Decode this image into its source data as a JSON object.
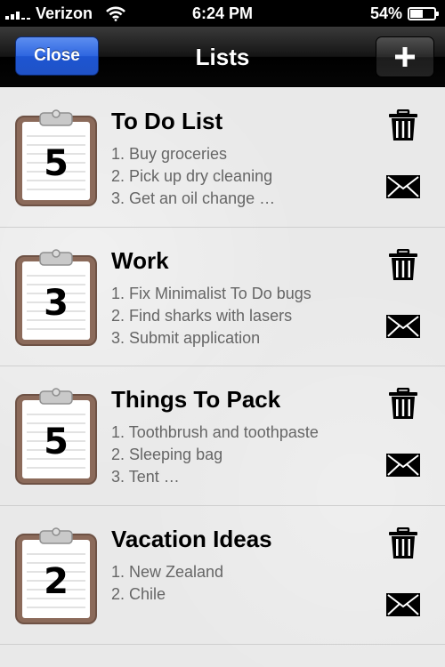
{
  "status_bar": {
    "carrier": "Verizon",
    "time": "6:24 PM",
    "battery_percent": "54%",
    "battery_level": 0.54
  },
  "nav": {
    "close_label": "Close",
    "title": "Lists",
    "add_label": "+"
  },
  "lists": [
    {
      "title": "To Do List",
      "count": "5",
      "items": [
        "1. Buy groceries",
        "2. Pick up dry cleaning",
        "3. Get an oil change …"
      ]
    },
    {
      "title": "Work",
      "count": "3",
      "items": [
        "1. Fix Minimalist To Do bugs",
        "2. Find sharks with lasers",
        "3. Submit application"
      ]
    },
    {
      "title": "Things To Pack",
      "count": "5",
      "items": [
        "1. Toothbrush and toothpaste",
        "2. Sleeping bag",
        "3. Tent …"
      ]
    },
    {
      "title": "Vacation Ideas",
      "count": "2",
      "items": [
        "1. New Zealand",
        "2. Chile"
      ]
    }
  ],
  "icons": {
    "signal": "signal-bars-icon",
    "wifi": "wifi-icon",
    "battery": "battery-icon",
    "clipboard": "clipboard-icon",
    "trash": "trash-icon",
    "mail": "mail-icon",
    "plus": "plus-icon"
  },
  "colors": {
    "close_button": "#2e66e0",
    "nav_bar": "#141414",
    "list_background": "#e9e9e9",
    "clipboard_frame": "#8b6a5a"
  }
}
